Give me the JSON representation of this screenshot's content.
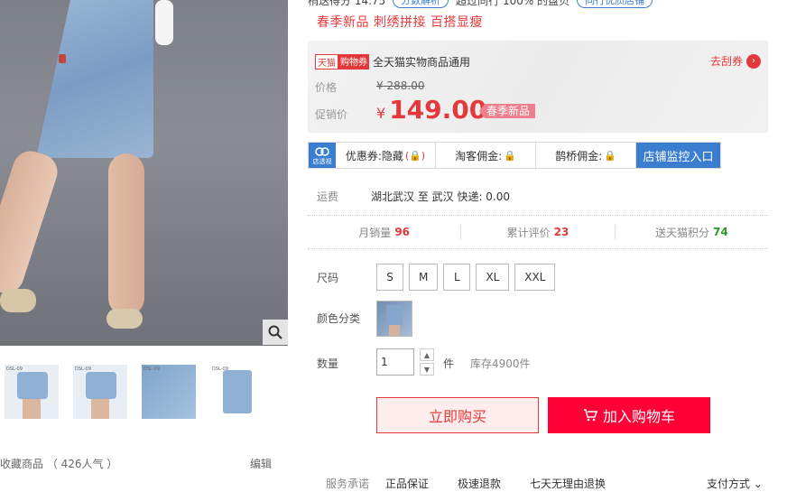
{
  "top": {
    "partial_text": "稍送得分 14.75",
    "pill1": "分数解析",
    "partial_text2": "超过同行 100% 的盘贝",
    "pill2": "同行优质店铺"
  },
  "promo_line": "春季新品 刺绣拼接 百搭显瘦",
  "price_box": {
    "tmall_tag": "天猫",
    "coupon_tag": "购物券",
    "coupon_text": "全天猫实物商品通用",
    "get_coupon": "去刮券",
    "orig_label": "价格",
    "orig_yen": "¥",
    "orig_price": "288.00",
    "promo_label": "促销价",
    "promo_yen": "¥",
    "promo_price": "149.00",
    "badge": "春季新品"
  },
  "monitor": {
    "logo_text": "店透视",
    "coupon_hidden": "优惠券:隐藏",
    "taoke": "淘客佣金:",
    "queqiao": "鹊桥佣金:",
    "entry": "店铺监控入口"
  },
  "shipping": {
    "label": "运费",
    "value": "湖北武汉 至 武汉 快递: 0.00"
  },
  "stats": {
    "monthly_label": "月销量",
    "monthly_value": "96",
    "reviews_label": "累计评价",
    "reviews_value": "23",
    "points_label": "送天猫积分",
    "points_value": "74"
  },
  "size": {
    "label": "尺码",
    "options": [
      "S",
      "M",
      "L",
      "XL",
      "XXL"
    ]
  },
  "color": {
    "label": "颜色分类"
  },
  "quantity": {
    "label": "数量",
    "value": "1",
    "unit": "件",
    "stock": "库存4900件"
  },
  "buttons": {
    "buy_now": "立即购买",
    "add_cart": "加入购物车"
  },
  "service": {
    "label": "服务承诺",
    "items": [
      "正品保证",
      "极速退款",
      "七天无理由退换"
    ],
    "pay": "支付方式"
  },
  "left": {
    "favorite": "收藏商品 （ 426人气 ）",
    "edit": "编辑",
    "thumb_tag": "DSL-09"
  }
}
